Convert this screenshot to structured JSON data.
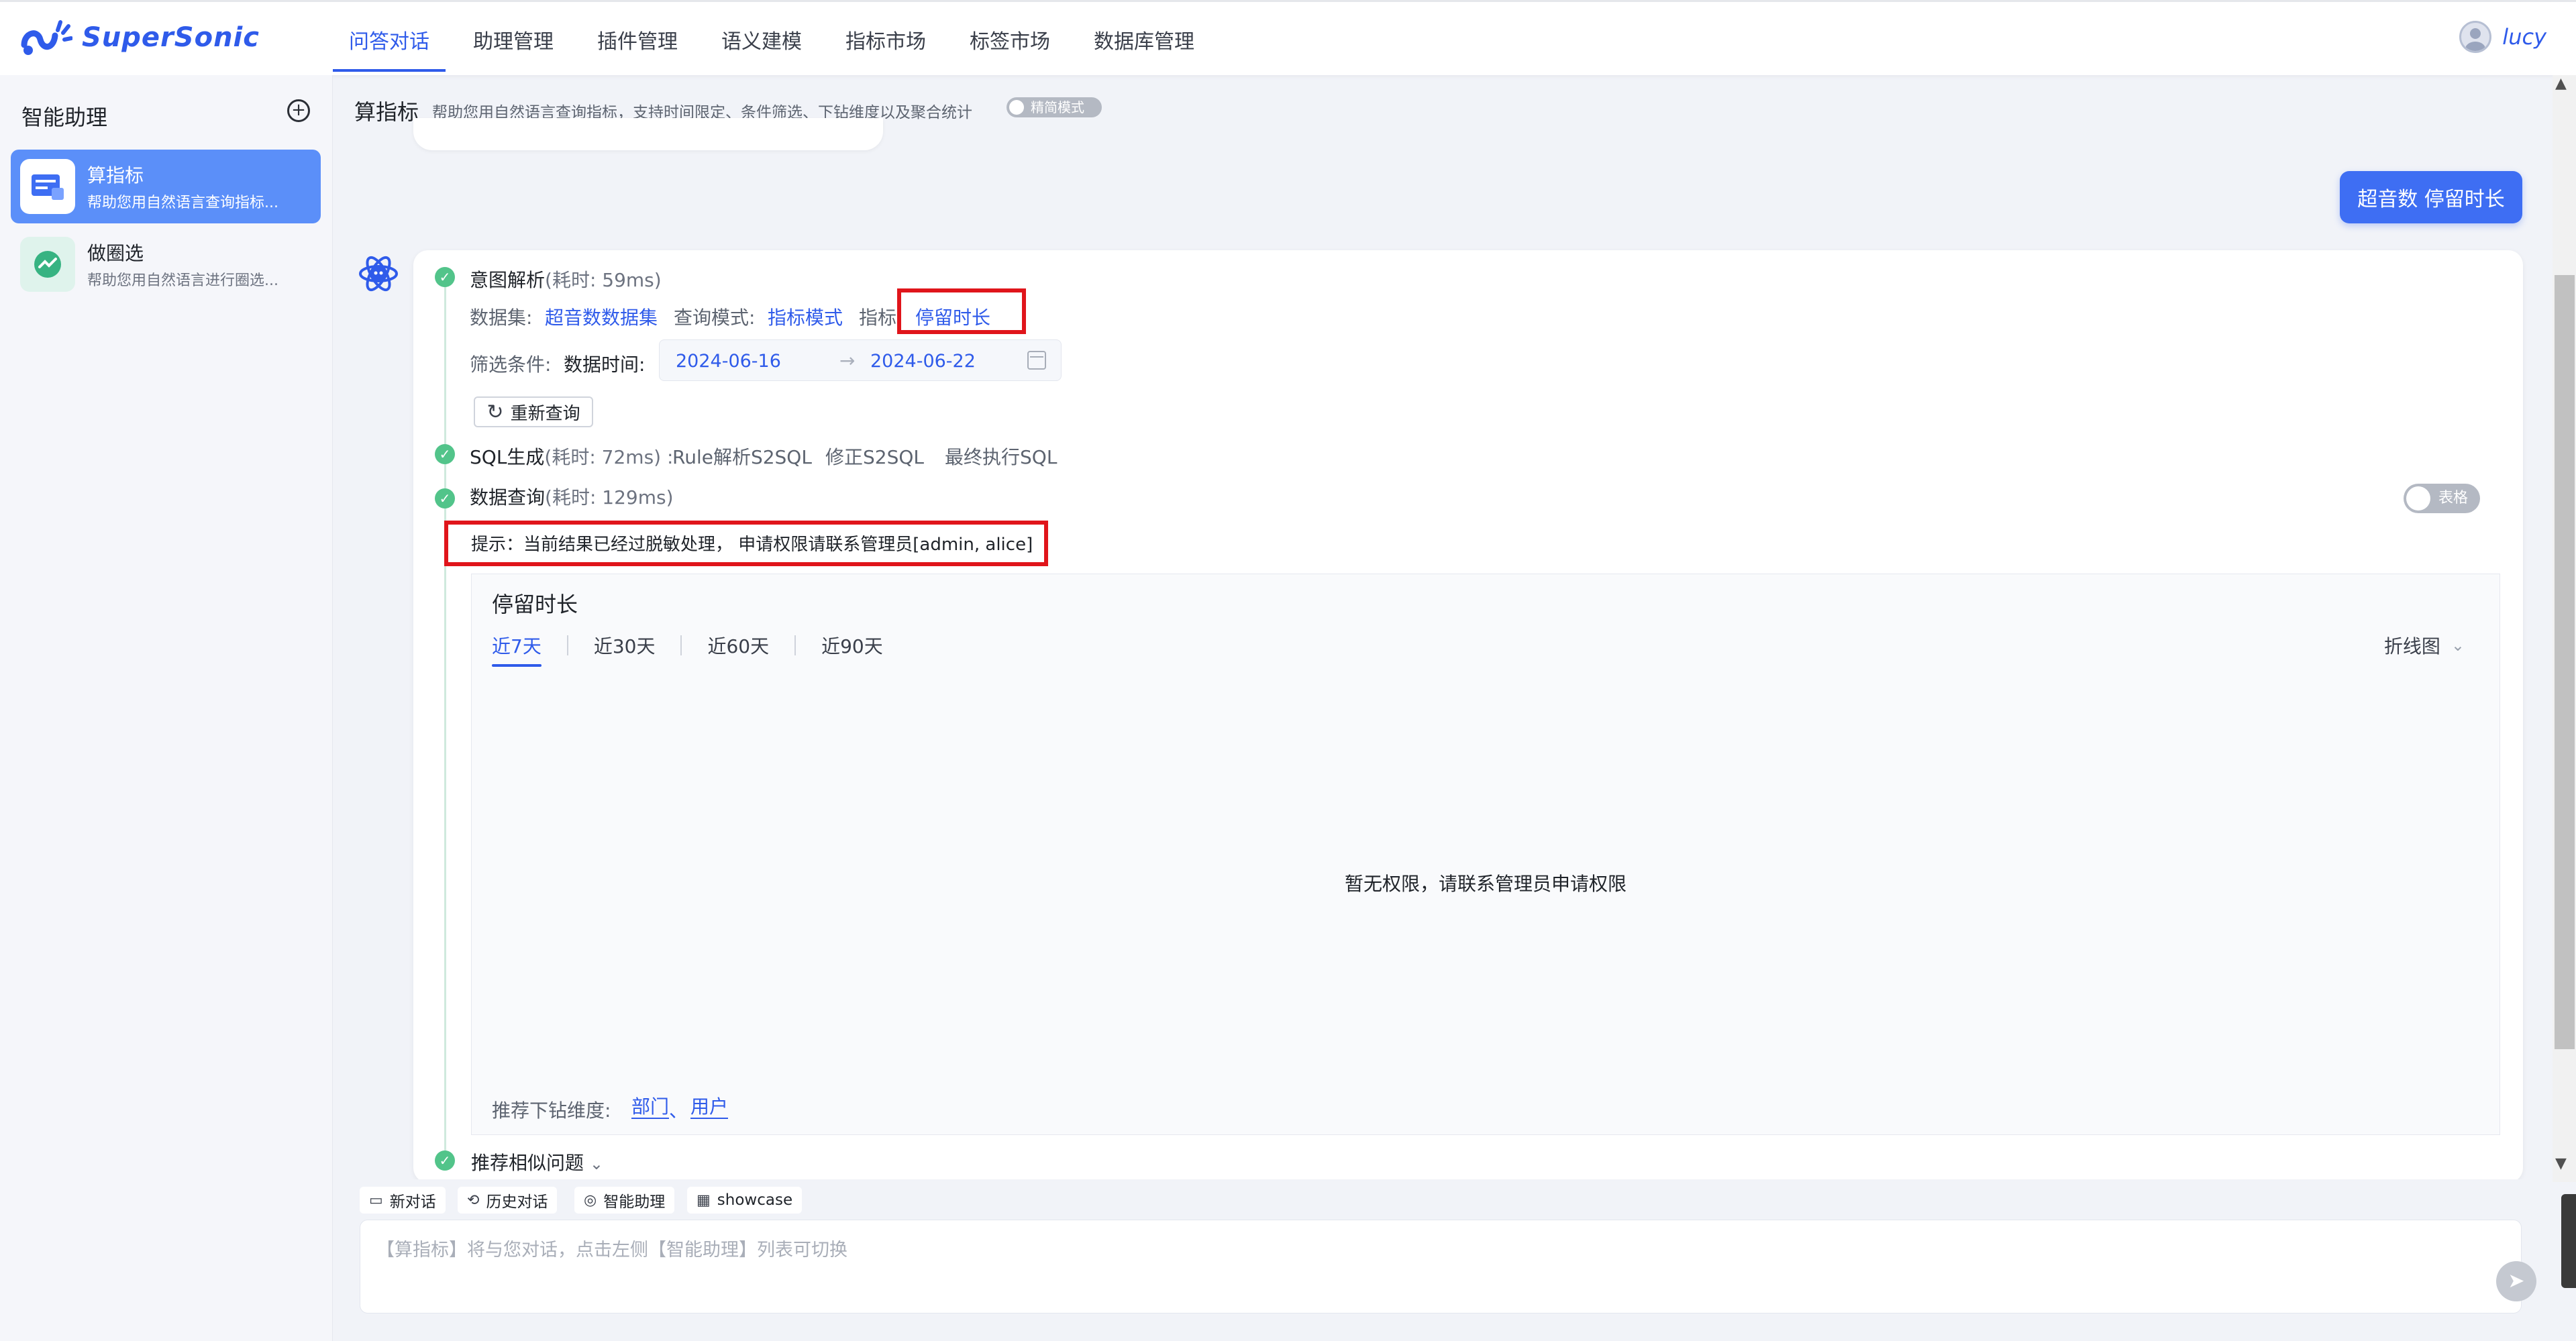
{
  "brand": {
    "name": "SuperSonic",
    "color": "#2f5bea"
  },
  "nav": {
    "items": [
      "问答对话",
      "助理管理",
      "插件管理",
      "语义建模",
      "指标市场",
      "标签市场",
      "数据库管理"
    ],
    "active_index": 0
  },
  "user": {
    "name": "lucy",
    "avatar_icon": "user-avatar-icon"
  },
  "sidebar": {
    "title": "智能助理",
    "add_icon": "plus-circle-icon",
    "agents": [
      {
        "name": "算指标",
        "desc": "帮助您用自然语言查询指标...",
        "icon": "metric-card-icon",
        "active": true
      },
      {
        "name": "做圈选",
        "desc": "帮助您用自然语言进行圈选...",
        "icon": "trend-circle-icon",
        "active": false
      }
    ]
  },
  "header": {
    "title": "算指标",
    "desc": "帮助您用自然语言查询指标，支持时间限定、条件筛选、下钻维度以及聚合统计",
    "simple_mode_label": "精简模式",
    "simple_mode_on": false
  },
  "question": "超音数 停留时长",
  "answer": {
    "intent": {
      "title": "意图解析",
      "time": "(耗时: 59ms)",
      "dataset_label": "数据集:",
      "dataset_value": "超音数数据集",
      "mode_label": "查询模式:",
      "mode_value": "指标模式",
      "metric_label": "指标:",
      "metric_value": "停留时长",
      "filter_label": "筛选条件:",
      "date_label": "数据时间:",
      "date_start": "2024-06-16",
      "date_end": "2024-06-22",
      "requery_label": "重新查询"
    },
    "sql": {
      "title": "SQL生成",
      "time": "(耗时: 72ms) :",
      "links": [
        "Rule解析S2SQL",
        "修正S2SQL",
        "最终执行SQL"
      ]
    },
    "query": {
      "title": "数据查询",
      "time": "(耗时: 129ms)",
      "table_toggle_label": "表格",
      "table_toggle_on": false,
      "hint": "提示：当前结果已经过脱敏处理， 申请权限请联系管理员[admin, alice]"
    },
    "chart": {
      "title": "停留时长",
      "ranges": [
        "近7天",
        "近30天",
        "近60天",
        "近90天"
      ],
      "active_range": 0,
      "chart_type": "折线图",
      "no_permission": "暂无权限，请联系管理员申请权限",
      "drill_label": "推荐下钻维度:",
      "drill_dims": [
        "部门",
        "用户"
      ],
      "drill_sep": "、"
    },
    "similar": {
      "title": "推荐相似问题"
    }
  },
  "quick_actions": [
    {
      "label": "新对话",
      "icon": "chat-plus-icon"
    },
    {
      "label": "历史对话",
      "icon": "history-icon"
    },
    {
      "label": "智能助理",
      "icon": "robot-icon"
    },
    {
      "label": "showcase",
      "icon": "grid-icon"
    }
  ],
  "input": {
    "placeholder": "【算指标】将与您对话，点击左侧【智能助理】列表可切换",
    "value": ""
  }
}
